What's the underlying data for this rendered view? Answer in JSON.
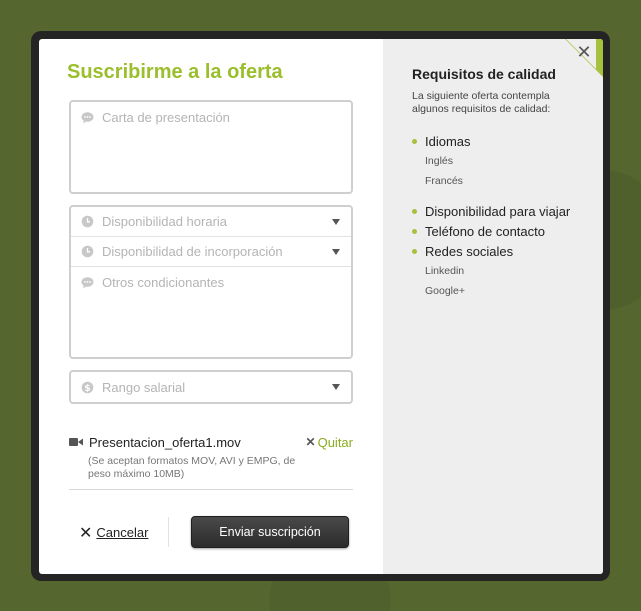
{
  "form": {
    "title": "Suscribirme a la oferta",
    "cover_letter_placeholder": "Carta de presentación",
    "availability_hours_placeholder": "Disponibilidad horaria",
    "availability_start_placeholder": "Disponibilidad de incorporación",
    "other_conditions_placeholder": "Otros condicionantes",
    "salary_range_placeholder": "Rango salarial",
    "attachment": {
      "file_name": "Presentacion_oferta1.mov",
      "remove_label": "Quitar",
      "hint": "(Se aceptan formatos MOV, AVI y EMPG, de peso máximo 10MB)"
    },
    "cancel_label": "Cancelar",
    "submit_label": "Enviar suscripción"
  },
  "requirements": {
    "title": "Requisitos de calidad",
    "subtitle": "La siguiente oferta contempla algunos requisitos de calidad:",
    "items": [
      {
        "label": "Idiomas",
        "sub": [
          "Inglés",
          "Francés"
        ]
      },
      {
        "label": "Disponibilidad para viajar",
        "sub": []
      },
      {
        "label": "Teléfono de contacto",
        "sub": []
      },
      {
        "label": "Redes sociales",
        "sub": [
          "Linkedin",
          "Google+"
        ]
      }
    ]
  },
  "colors": {
    "accent": "#9bbe2c",
    "background": "#55662f",
    "panel": "#eeeeef"
  },
  "icons": [
    "close-icon",
    "chat-bubble-icon",
    "clock-icon",
    "dollar-icon",
    "video-camera-icon",
    "chevron-down-icon"
  ]
}
